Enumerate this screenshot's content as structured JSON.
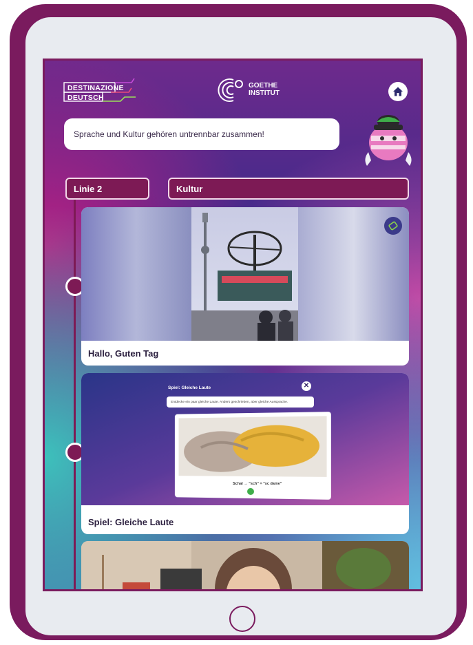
{
  "device": {
    "frame_color": "#7a1b5e",
    "bezel_color": "#e8ebf0"
  },
  "header": {
    "logo_dd_line1": "DESTINAZIONE",
    "logo_dd_line2": "DEUTSCH",
    "goethe_line1": "GOETHE",
    "goethe_line2": "INSTITUT",
    "home_icon": "home-icon"
  },
  "speech_bubble": "Sprache und Kultur gehören untrennbar zusammen!",
  "tabs": {
    "line_label": "Linie 2",
    "section_label": "Kultur"
  },
  "cards": [
    {
      "label": "Hallo, Guten Tag",
      "badge_icon": "ticket-icon"
    },
    {
      "label": "Spiel: Gleiche Laute",
      "game_title": "Spiel: Gleiche Laute",
      "game_instruction": "Entdecke ein paar gleiche Laute. Anders geschrieben, aber gleiche Aussprache.",
      "game_formula": "Schal → \"sch\" = \"sc daine\""
    },
    {
      "label": ""
    }
  ],
  "colors": {
    "accent": "#7d1a55",
    "text_dark": "#2d2140"
  }
}
